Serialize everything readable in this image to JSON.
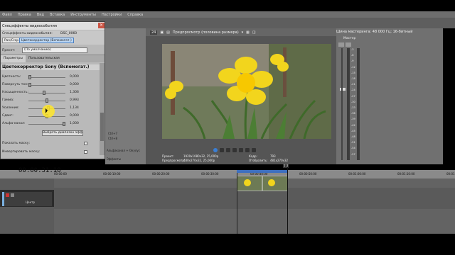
{
  "menu": [
    "Файл",
    "Правка",
    "Вид",
    "Вставка",
    "Инструменты",
    "Настройки",
    "Справка"
  ],
  "fx": {
    "title": "Спецэффекты видеособытия",
    "chain_label": "Спецэффекты видеособытия:",
    "chain_file": "DSC_0060",
    "chips": [
      "Pan/Crop",
      "Цветокорректор (Вспомогат.)"
    ],
    "preset": "(По умолчанию)",
    "preset_label": "Пресет:",
    "tabs": [
      "Параметры",
      "Пользовательская"
    ],
    "plugin": "Цветокорректор Sony (Вспомогат.)",
    "params": [
      {
        "label": "Цветность:",
        "value": "0,000",
        "level": 0.0
      },
      {
        "label": "Повернуть тон:",
        "value": "0,000",
        "level": 0.0
      },
      {
        "label": "Насыщенность:",
        "value": "1,306",
        "level": 0.42
      },
      {
        "label": "Гамма:",
        "value": "0,993",
        "level": 0.5
      },
      {
        "label": "Усиление:",
        "value": "1,134",
        "level": 0.55
      },
      {
        "label": "Сдвиг:",
        "value": "0,000",
        "level": 0.5
      },
      {
        "label": "Альфа-канал:",
        "value": "1,000",
        "level": 1.0
      }
    ],
    "select_button": "Выбрать диапазон эфф",
    "checks": [
      "Показать маску:",
      "Инвертировать маску:"
    ],
    "side_text": [
      "Ctrl+7",
      "Ctrl+8",
      "Альфаканал + Окулус",
      "Эффекты"
    ]
  },
  "preview": {
    "mode": "Предпросмотр (половина размера)",
    "zoom": "24",
    "project_label": "Проект:",
    "project_value": "1920x1080x32, 25,000p",
    "preview_label": "Предпросмотр:",
    "preview_value": "480x270x32, 25,000p",
    "frame_label": "Кадр:",
    "frame_value": "793",
    "display_label": "Отобразить:",
    "display_value": "481x270x32"
  },
  "master": {
    "title": "Шина мастеринга",
    "format": "48 000 Гц; 16-битный",
    "label": "Мастер",
    "scale": [
      "-3",
      "-6",
      "-9",
      "-12",
      "-15",
      "-18",
      "-21",
      "-24",
      "-27",
      "-30",
      "-33",
      "-36",
      "-39",
      "-42",
      "-45",
      "-48",
      "-51",
      "-54",
      "-57"
    ]
  },
  "timeline": {
    "timecode": "00:00:31:18",
    "marks": [
      "00:00:00",
      "00:00:10:00",
      "00:00:20:00",
      "00:00:30:00",
      "00:00:40:00",
      "00:00:50:00",
      "00:01:00:00",
      "00:01:10:00",
      "00:01:20:00"
    ],
    "loop_label": "7:7",
    "track_pan": "Центр"
  },
  "colors": {
    "accent": "#3d6fbf",
    "highlight": "#ffe628"
  }
}
